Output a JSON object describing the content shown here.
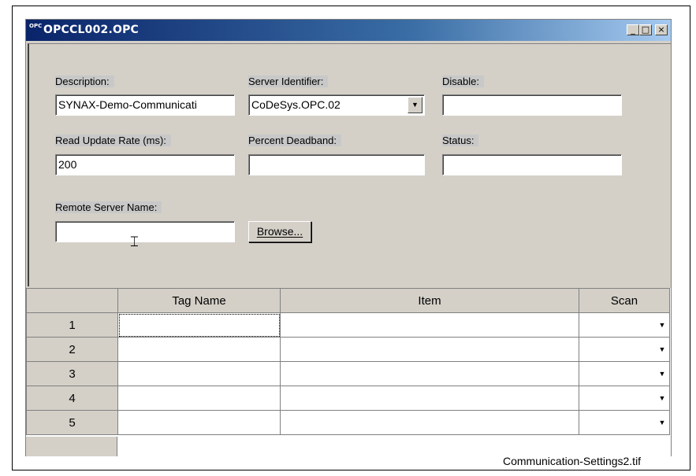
{
  "window": {
    "icon_text": "OPC",
    "title": "OPCCL002.OPC",
    "buttons": {
      "minimize": "_",
      "maximize": "□",
      "close": "×"
    }
  },
  "form": {
    "description": {
      "label": "Description:",
      "value": "SYNAX-Demo-Communicati"
    },
    "server_identifier": {
      "label": "Server Identifier:",
      "value": "CoDeSys.OPC.02"
    },
    "disable": {
      "label": "Disable:",
      "value": ""
    },
    "read_update_rate": {
      "label": "Read Update Rate (ms):",
      "value": "200"
    },
    "percent_deadband": {
      "label": "Percent Deadband:",
      "value": ""
    },
    "status": {
      "label": "Status:",
      "value": ""
    },
    "remote_server_name": {
      "label": "Remote Server Name:",
      "value": ""
    },
    "browse_button": "Browse...",
    "dropdown_arrow": "▼"
  },
  "grid": {
    "columns": [
      "",
      "Tag Name",
      "Item",
      "Scan"
    ],
    "rows": [
      {
        "num": "1",
        "tag": "",
        "item": "",
        "scan": ""
      },
      {
        "num": "2",
        "tag": "",
        "item": "",
        "scan": ""
      },
      {
        "num": "3",
        "tag": "",
        "item": "",
        "scan": ""
      },
      {
        "num": "4",
        "tag": "",
        "item": "",
        "scan": ""
      },
      {
        "num": "5",
        "tag": "",
        "item": "",
        "scan": ""
      }
    ],
    "scan_arrow": "▼"
  },
  "caption": "Communication-Settings2.tif",
  "colors": {
    "titlebar": "#0a246a",
    "face": "#d4d0c8"
  }
}
